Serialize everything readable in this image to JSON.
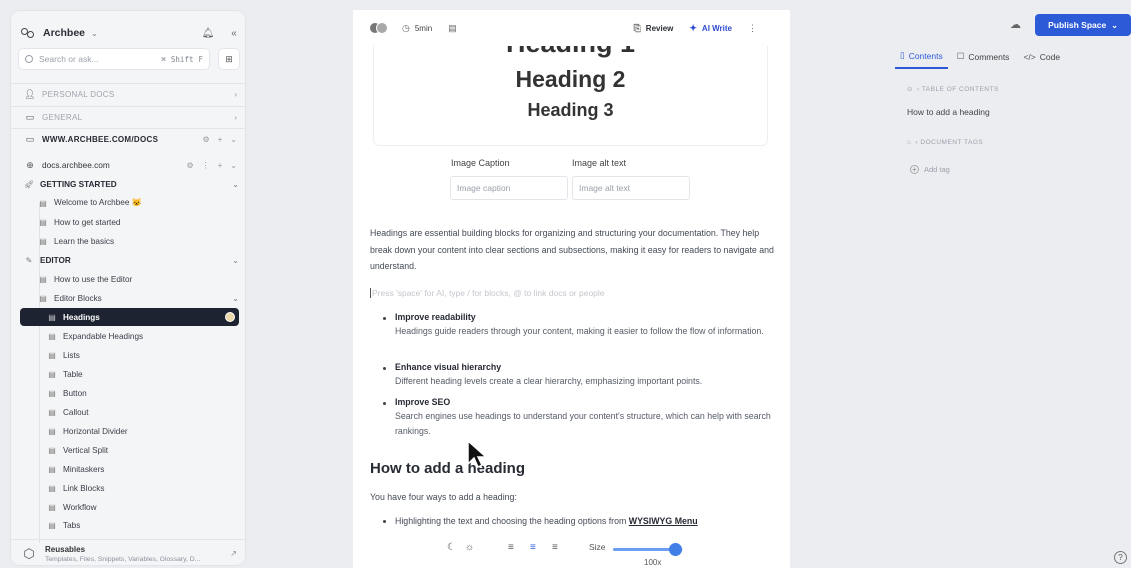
{
  "sidebar": {
    "workspace_name": "Archbee",
    "search_placeholder": "Search or ask...",
    "search_shortcut": [
      "⌘",
      "Shift",
      "F"
    ],
    "sections": {
      "personal": "PERSONAL DOCS",
      "general": "GENERAL",
      "website": "WWW.ARCHBEE.COM/DOCS"
    },
    "space_name": "docs.archbee.com",
    "tree": [
      {
        "label": "GETTING STARTED",
        "type": "category"
      },
      {
        "label": "Welcome to Archbee 😺",
        "type": "doc"
      },
      {
        "label": "How to get started",
        "type": "doc"
      },
      {
        "label": "Learn the basics",
        "type": "doc"
      },
      {
        "label": "EDITOR",
        "type": "category"
      },
      {
        "label": "How to use the Editor",
        "type": "doc"
      },
      {
        "label": "Editor Blocks",
        "type": "doc"
      },
      {
        "label": "Headings",
        "type": "doc",
        "active": true
      },
      {
        "label": "Expandable Headings",
        "type": "doc"
      },
      {
        "label": "Lists",
        "type": "doc"
      },
      {
        "label": "Table",
        "type": "doc"
      },
      {
        "label": "Button",
        "type": "doc"
      },
      {
        "label": "Callout",
        "type": "doc"
      },
      {
        "label": "Horizontal Divider",
        "type": "doc"
      },
      {
        "label": "Vertical Split",
        "type": "doc"
      },
      {
        "label": "Minitaskers",
        "type": "doc"
      },
      {
        "label": "Link Blocks",
        "type": "doc"
      },
      {
        "label": "Workflow",
        "type": "doc"
      },
      {
        "label": "Tabs",
        "type": "doc"
      }
    ],
    "reusables": {
      "title": "Reusables",
      "subtitle": "Templates, Files, Snippets, Variables, Glossary, D..."
    }
  },
  "toolbar": {
    "read_time": "5min",
    "review": "Review",
    "ai_write": "AI Write"
  },
  "editor": {
    "image_headings": [
      "Heading 1",
      "Heading 2",
      "Heading 3"
    ],
    "caption_label": "Image Caption",
    "alt_label": "Image alt text",
    "caption_placeholder": "Image caption",
    "alt_placeholder": "Image alt text",
    "intro": "Headings are essential building blocks for organizing and structuring your documentation. They help break down your content into clear sections and subsections, making it easy for readers to navigate and understand.",
    "slash_hint": "Press 'space' for AI, type / for blocks, @ to link docs or people",
    "bullets": [
      {
        "title": "Improve readability",
        "desc": "Headings guide readers through your content, making it easier to follow the flow of information."
      },
      {
        "title": "Enhance visual hierarchy",
        "desc": "Different heading levels create a clear hierarchy, emphasizing important points."
      },
      {
        "title": "Improve SEO",
        "desc": "Search engines use headings to understand your content's structure, which can help with search rankings."
      }
    ],
    "section_heading": "How to add a heading",
    "section_intro": "You have four ways to add a heading:",
    "bottom_bullet_text": "Highlighting the text and choosing the heading options from ",
    "bottom_bullet_link": "WYSIWYG Menu"
  },
  "size_control": {
    "label": "Size",
    "value_text": "100x",
    "level": 0.88
  },
  "right_panel": {
    "publish_label": "Publish Space",
    "tabs": [
      "Contents",
      "Comments",
      "Code"
    ],
    "toc_label": "TABLE OF CONTENTS",
    "toc_items": [
      "How to add a heading"
    ],
    "tags_label": "DOCUMENT TAGS",
    "add_tag": "Add tag"
  },
  "colors": {
    "accent": "#2d5bd7",
    "active_row": "#1d2330",
    "slider": "#3f7fe6"
  }
}
